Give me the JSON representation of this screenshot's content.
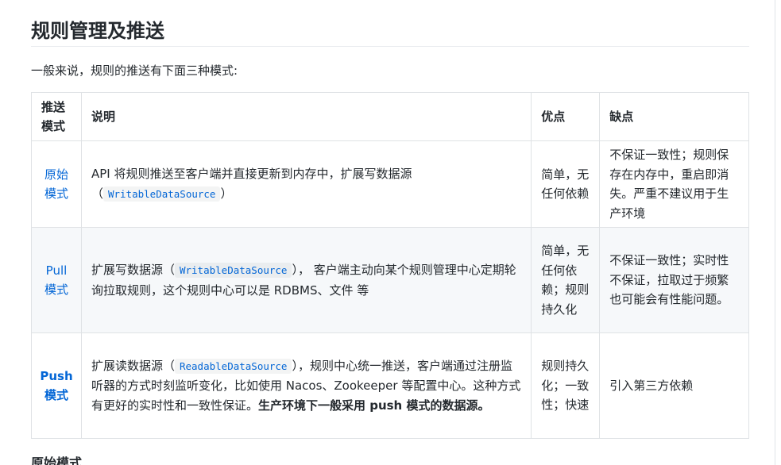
{
  "heading": "规则管理及推送",
  "intro": "一般来说，规则的推送有下面三种模式:",
  "table": {
    "headers": {
      "mode": "推送模式",
      "desc": "说明",
      "pros": "优点",
      "cons": "缺点"
    },
    "rows": [
      {
        "mode_line1": "原始",
        "mode_line2": "模式",
        "desc_pre": "API 将规则推送至客户端并直接更新到内存中，扩展写数据源（",
        "desc_code": "WritableDataSource",
        "desc_post": "）",
        "desc_bold": "",
        "pros": "简单，无任何依赖",
        "cons": "不保证一致性；规则保存在内存中，重启即消失。严重不建议用于生产环境"
      },
      {
        "mode_line1": "Pull",
        "mode_line2": "模式",
        "desc_pre": "扩展写数据源（",
        "desc_code": "WritableDataSource",
        "desc_post": "）， 客户端主动向某个规则管理中心定期轮询拉取规则，这个规则中心可以是 RDBMS、文件 等",
        "desc_bold": "",
        "pros": "简单，无任何依赖；规则持久化",
        "cons": "不保证一致性；实时性不保证，拉取过于频繁也可能会有性能问题。"
      },
      {
        "mode_line1": "Push",
        "mode_line2": "模式",
        "desc_pre": "扩展读数据源（",
        "desc_code": "ReadableDataSource",
        "desc_post": "），规则中心统一推送，客户端通过注册监听器的方式时刻监听变化，比如使用 Nacos、Zookeeper 等配置中心。这种方式有更好的实时性和一致性保证。",
        "desc_bold": "生产环境下一般采用 push 模式的数据源。",
        "pros": "规则持久化；一致性；快速",
        "cons": "引入第三方依赖"
      }
    ]
  },
  "next_heading": "原始模式"
}
